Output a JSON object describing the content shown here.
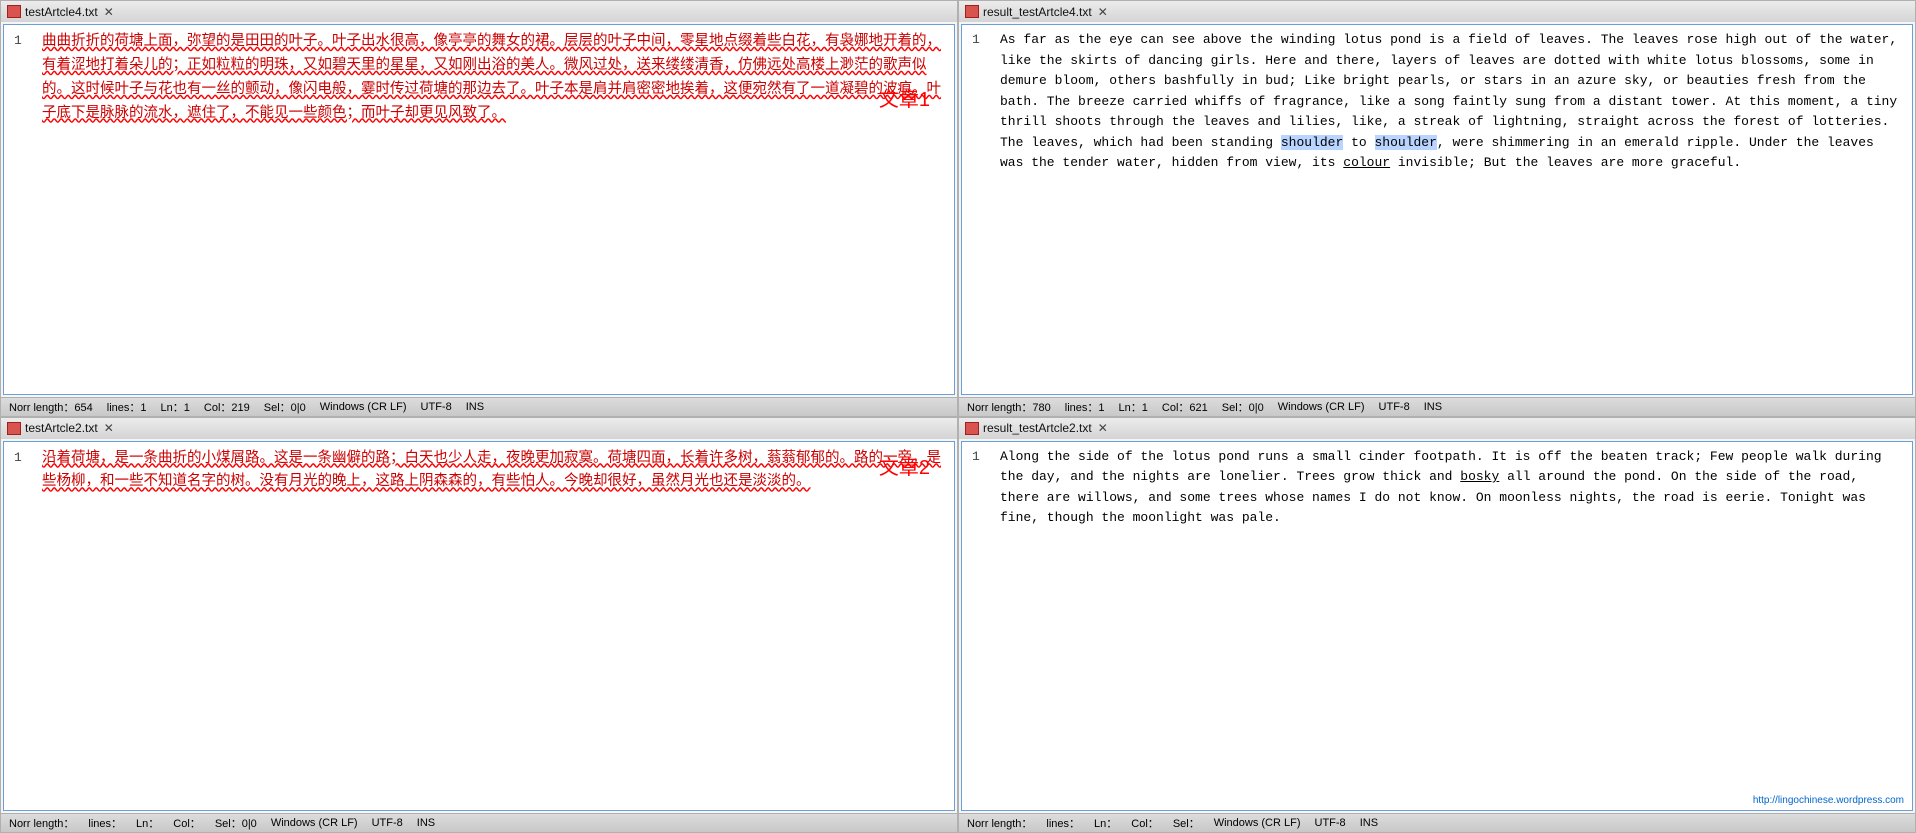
{
  "panes": {
    "top_left": {
      "title": "testArtcle4.txt",
      "close": "✕",
      "content_cn": "曲曲折折的荷塘上面，弥望的是田田的叶子。叶子出水很高，像亭亭的舞女的裙。层层的叶子中间，零星地点缀着些白花，有袅娜地开着的，有着涩地打着朵儿的；正如粒粒的明珠，又如碧天里的星星，又如刚出浴的美人。微风过处，送来缕缕清香，仿佛远处高楼上渺茫的歌声似的。这时候叶子与花也有一丝的颤动，像闪电般，霎时传过荷塘的那边去了。叶子本是肩并肩密密地挨着，这便宛然有了一道凝碧的波痕。叶子底下是脉脉的流水，遮住了，不能见一些颜色；而叶子却更见风致了。",
      "line": "1",
      "chapter": "文章1",
      "status": {
        "norr_length": "Norr length：654",
        "lines": "lines：1",
        "ln": "Ln：1",
        "col": "Col：219",
        "sel": "Sel：0|0",
        "eol": "Windows (CR LF)",
        "encoding": "UTF-8",
        "ins": "INS"
      }
    },
    "top_right": {
      "title": "result_testArtcle4.txt",
      "close": "✕",
      "content_en": "As far as the eye can see above the winding lotus pond is a field of leaves. The leaves rose high out of the water, like the skirts of dancing girls. Here and there, layers of leaves are dotted with white lotus blossoms, some in demure bloom, others bashfully in bud; Like bright pearls, or stars in an azure sky, or beauties fresh from the bath. The breeze carried whiffs of fragrance, like a song faintly sung from a distant tower. At this moment, a tiny thrill shoots through the leaves and lilies, like, a streak of lightning, straight across the forest of lotteries. The leaves, which had been standing shoulder to shoulder, were shimmering in an emerald ripple. Under the leaves was the tender water, hidden from view, its colour invisible; But the leaves are more graceful.",
      "line": "1",
      "highlight_word": "shoulder",
      "underline_word": "colour",
      "status": {
        "norr_length": "Norr length：780",
        "lines": "lines：1",
        "ln": "Ln：1",
        "col": "Col：621",
        "sel": "Sel：0|0",
        "eol": "Windows (CR LF)",
        "encoding": "UTF-8",
        "ins": "INS"
      }
    },
    "bottom_left": {
      "title": "testArtcle2.txt",
      "close": "✕",
      "content_cn": "沿着荷塘，是一条曲折的小煤屑路。这是一条幽僻的路；白天也少人走，夜晚更加寂寞。荷塘四面，长着许多树，蓊蓊郁郁的。路的一旁，是些杨柳，和一些不知道名字的树。没有月光的晚上，这路上阴森森的，有些怕人。今晚却很好，虽然月光也还是淡淡的。",
      "line": "1",
      "chapter": "文章2",
      "status": {
        "norr_length": "Norr length：",
        "lines": "lines：",
        "ln": "Ln：",
        "col": "Col：",
        "sel": "Sel：0|0",
        "eol": "Windows (CR LF)",
        "encoding": "UTF-8",
        "ins": "INS"
      }
    },
    "bottom_right": {
      "title": "result_testArtcle2.txt",
      "close": "✕",
      "content_en": "Along the side of the lotus pond runs a small cinder footpath. It is off the beaten track; Few people walk during the day, and the nights are lonelier. Trees grow thick and bosky all around the pond. On the side of the road, there are willows, and some trees whose names I do not know. On moonless nights, the road is eerie. Tonight was fine, though the moonlight was pale.",
      "line": "1",
      "underline_word": "bosky",
      "url": "http://lingochinese.wordpress.com",
      "status": {
        "norr_length": "Norr length：",
        "lines": "lines：",
        "ln": "Ln：",
        "col": "Col：",
        "sel": "Sel：",
        "eol": "Windows (CR LF)",
        "encoding": "UTF-8",
        "ins": "INS"
      }
    }
  },
  "labels": {
    "norr_length": "Norr length",
    "lines": "lines",
    "ln": "Ln",
    "col": "Col",
    "sel": "Sel",
    "windows_eol": "Windows (CR LF)",
    "utf8": "UTF-8",
    "ins": "INS"
  }
}
